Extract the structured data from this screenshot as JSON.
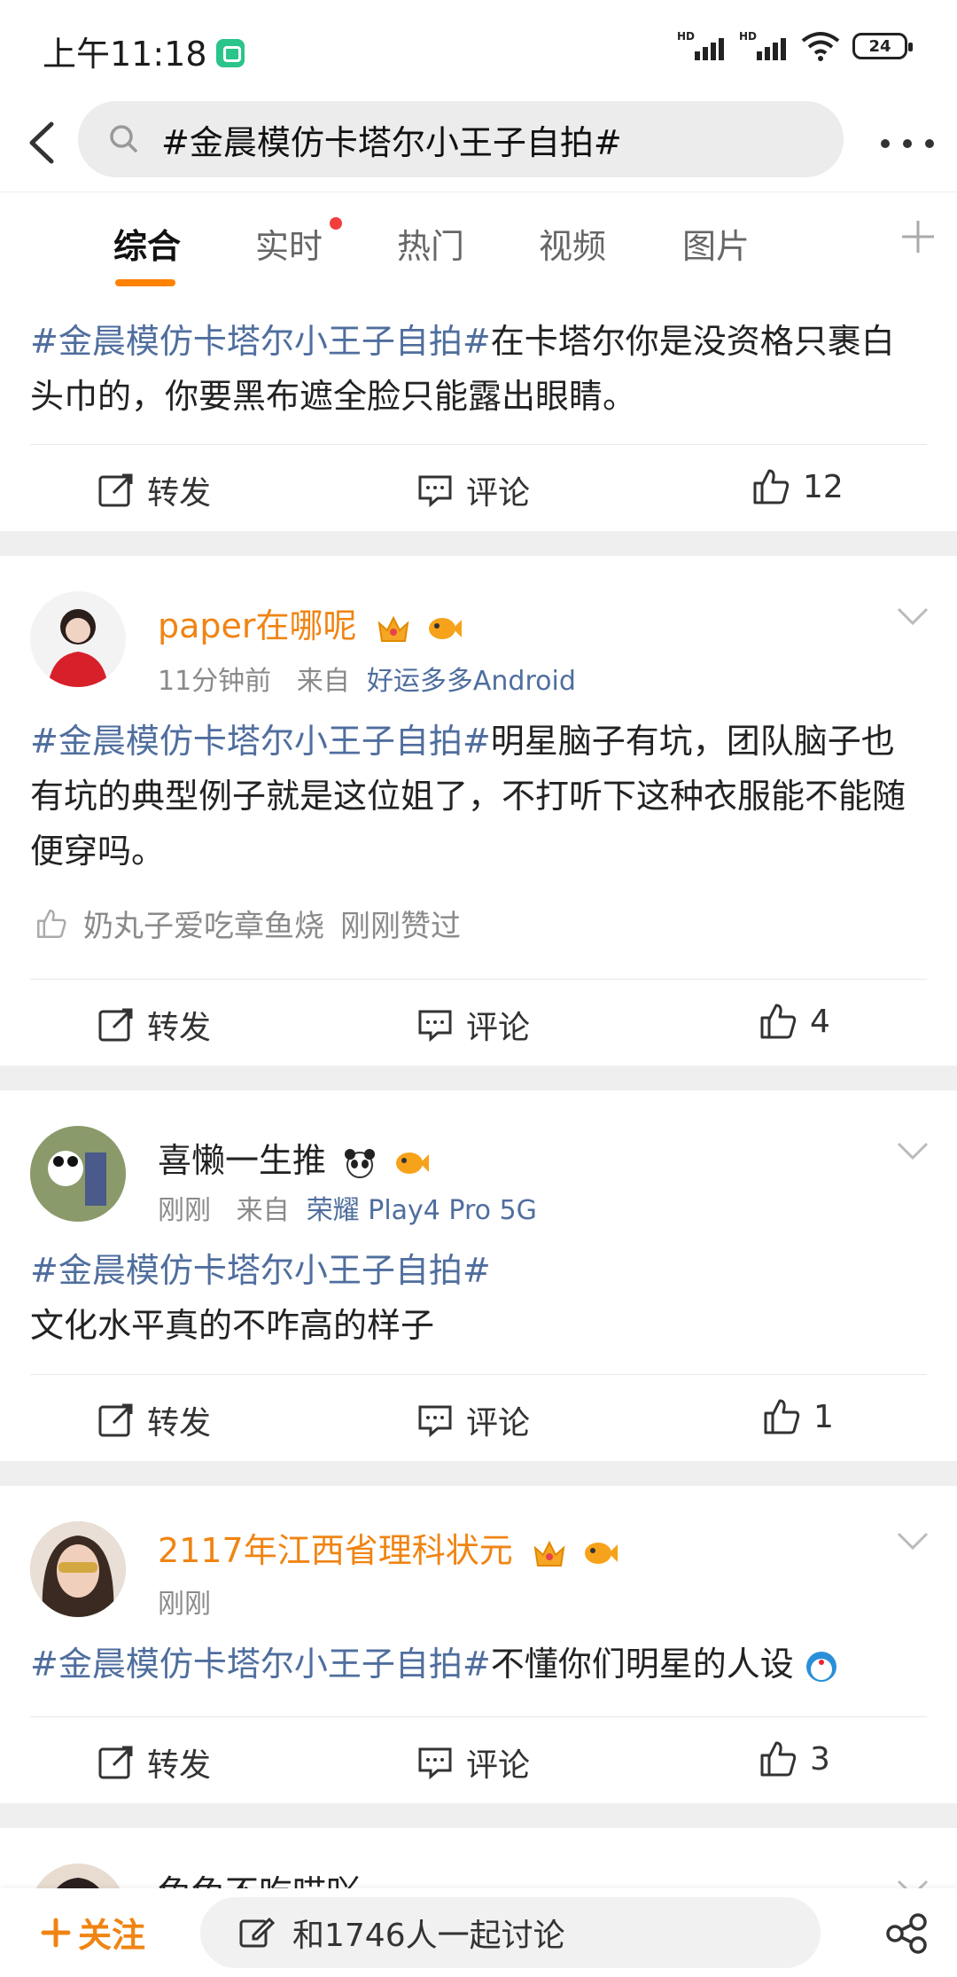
{
  "status": {
    "time": "上午11:18",
    "battery": "24"
  },
  "search": {
    "query": "#金晨模仿卡塔尔小王子自拍#"
  },
  "tabs": [
    "综合",
    "实时",
    "热门",
    "视频",
    "图片"
  ],
  "posts": [
    {
      "topic": "#金晨模仿卡塔尔小王子自拍#",
      "text": "在卡塔尔你是没资格只裹白头巾的，你要黑布遮全脸只能露出眼睛。",
      "repost": "转发",
      "comment": "评论",
      "likes": "12"
    },
    {
      "username": "paper在哪呢",
      "time": "11分钟前",
      "from": "来自",
      "source": "好运多多Android",
      "topic": "#金晨模仿卡塔尔小王子自拍#",
      "text": "明星脑子有坑，团队脑子也有坑的典型例子就是这位姐了，不打听下这种衣服能不能随便穿吗。",
      "liked_by": "奶丸子爱吃章鱼烧",
      "liked_when": "刚刚赞过",
      "repost": "转发",
      "comment": "评论",
      "likes": "4"
    },
    {
      "username": "喜懒一生推",
      "time": "刚刚",
      "from": "来自",
      "source": "荣耀 Play4 Pro 5G",
      "topic": "#金晨模仿卡塔尔小王子自拍#",
      "text": "文化水平真的不咋高的样子",
      "repost": "转发",
      "comment": "评论",
      "likes": "1"
    },
    {
      "username": "2117年江西省理科状元",
      "time": "刚刚",
      "topic": "#金晨模仿卡塔尔小王子自拍#",
      "text": "不懂你们明星的人设",
      "repost": "转发",
      "comment": "评论",
      "likes": "3"
    },
    {
      "username": "兔兔不吃喵吖"
    }
  ],
  "bottom": {
    "follow": "关注",
    "discuss": "和1746人一起讨论"
  },
  "colors": {
    "accent": "#ff8200",
    "topic": "#4f6e9e",
    "vip": "#f08413"
  }
}
